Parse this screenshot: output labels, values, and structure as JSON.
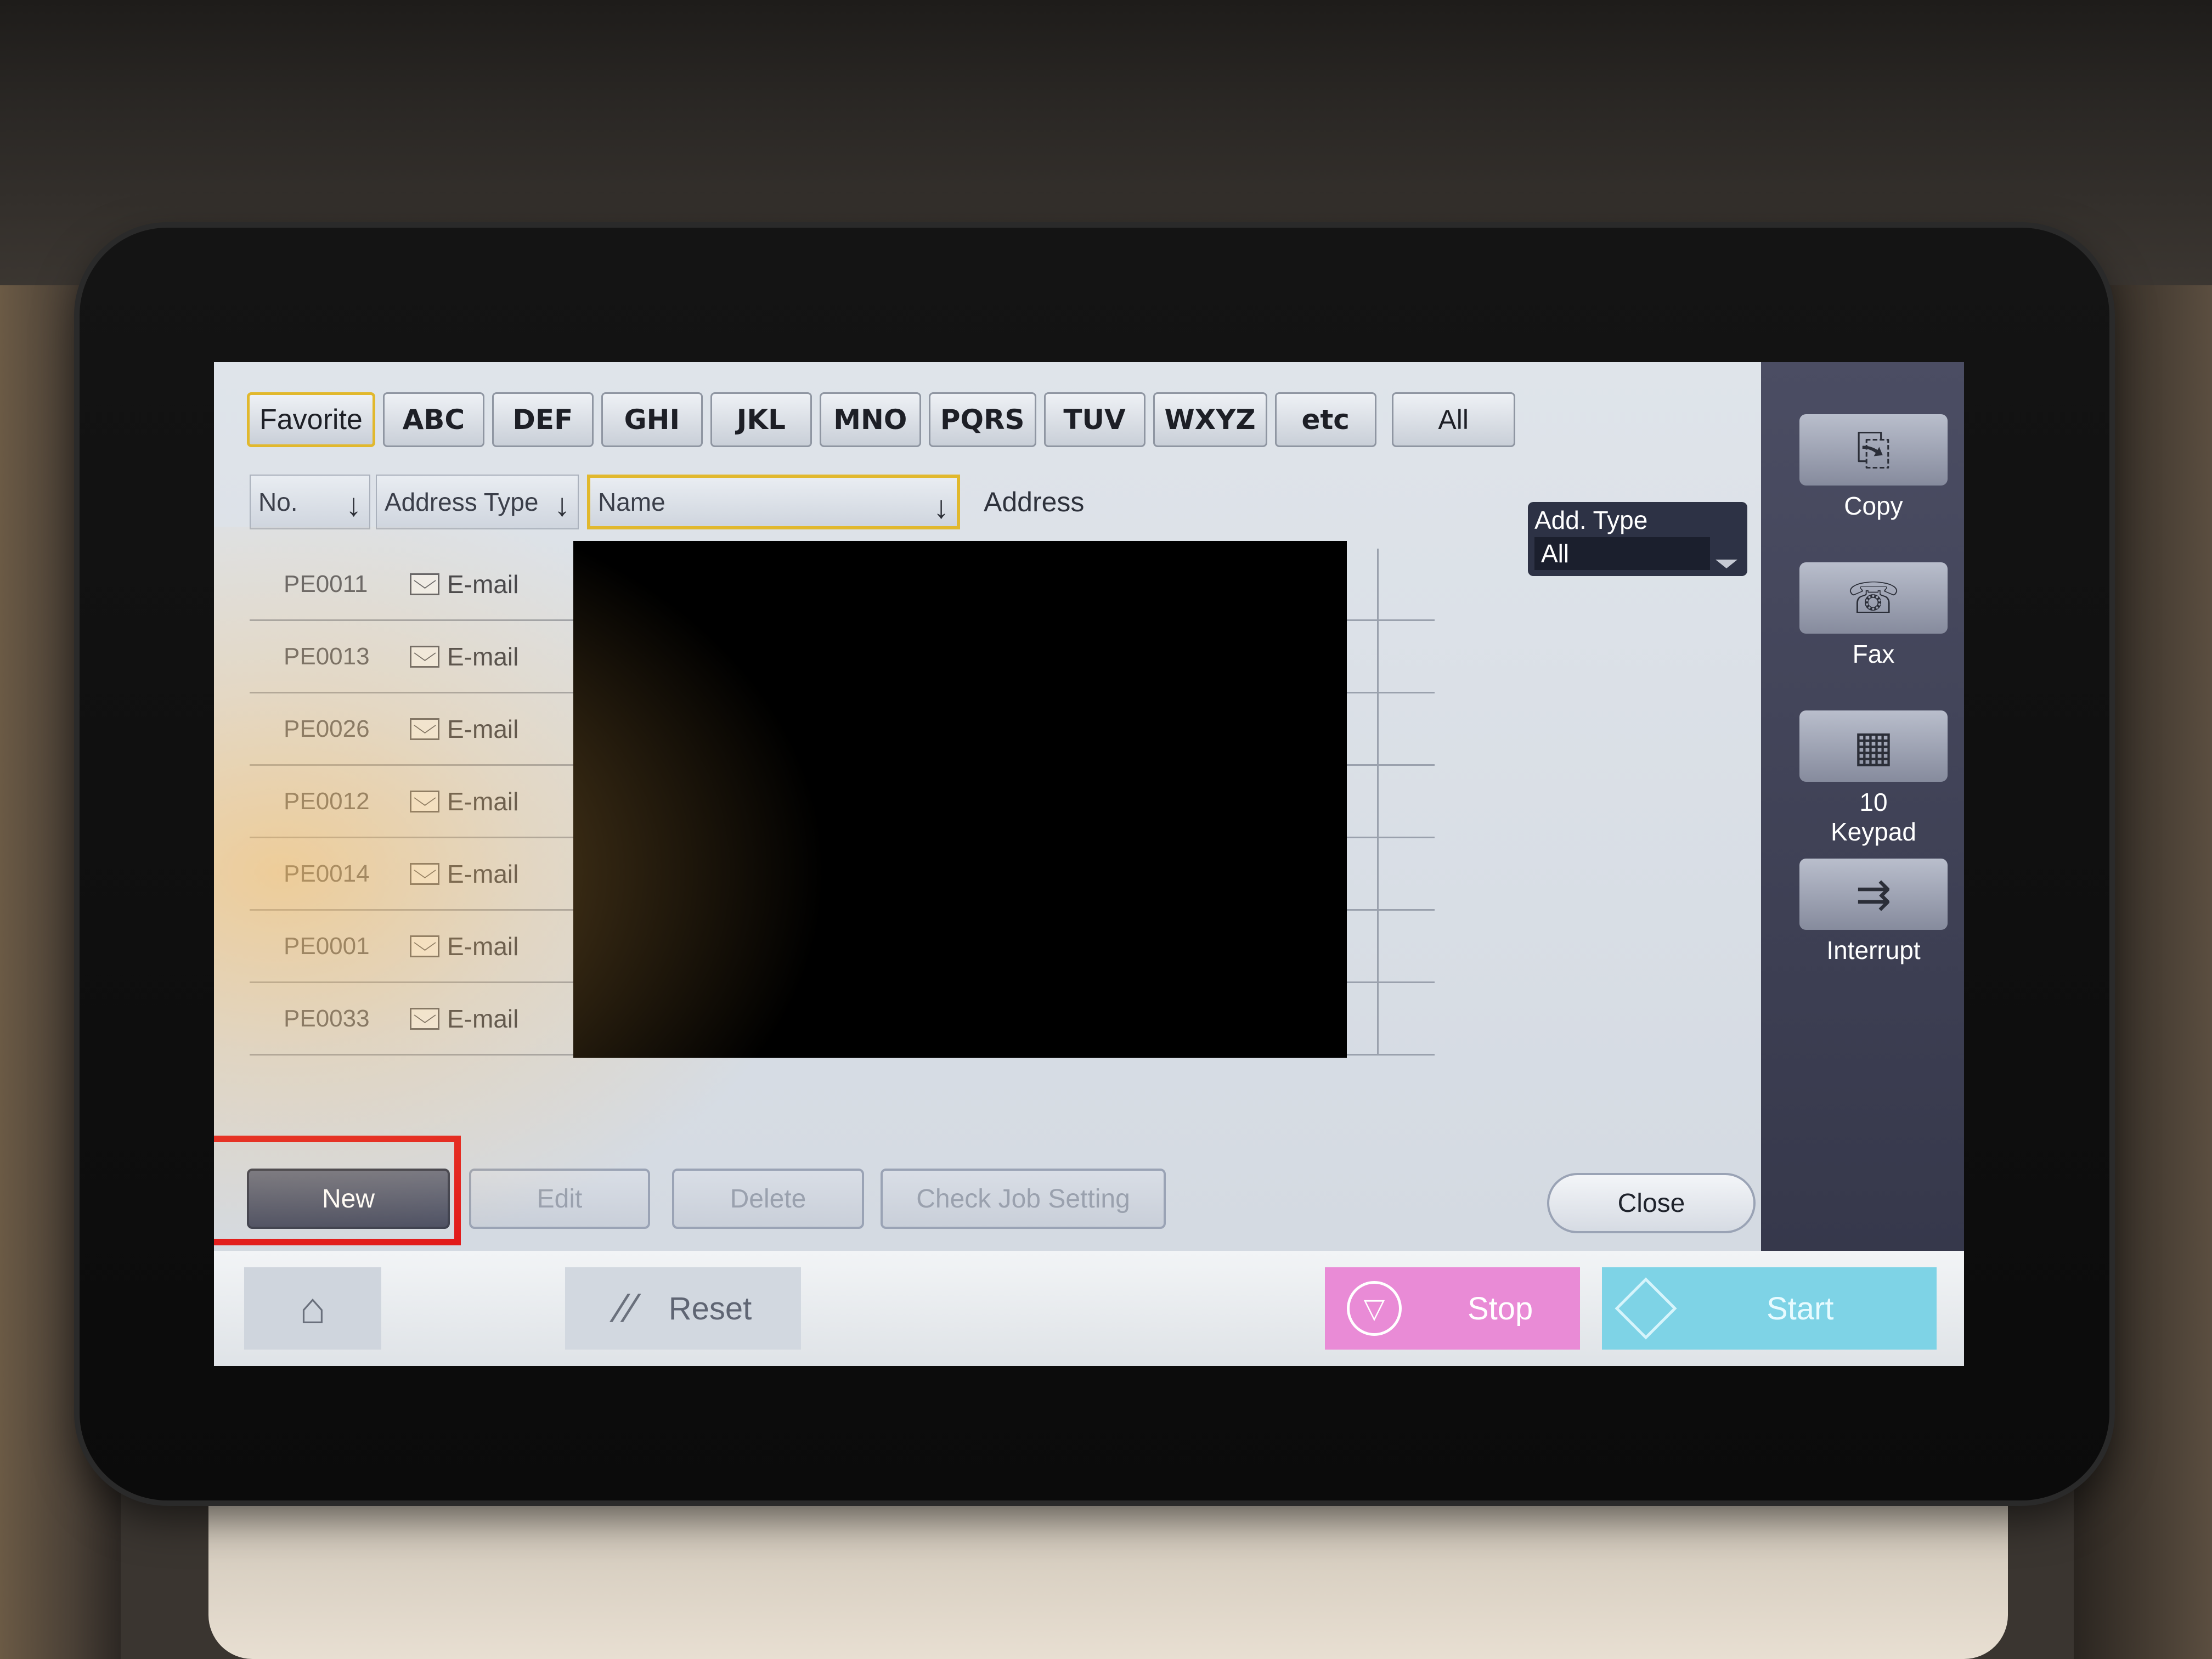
{
  "tabs": {
    "favorite": "Favorite",
    "abc": "ABC",
    "def": "DEF",
    "ghi": "GHI",
    "jkl": "JKL",
    "mno": "MNO",
    "pqrs": "PQRS",
    "tuv": "TUV",
    "wxyz": "WXYZ",
    "etc": "etc",
    "all": "All"
  },
  "columns": {
    "no": "No.",
    "address_type": "Address Type",
    "name": "Name",
    "address": "Address"
  },
  "rows": [
    {
      "no": "PE0011",
      "type": "E-mail"
    },
    {
      "no": "PE0013",
      "type": "E-mail"
    },
    {
      "no": "PE0026",
      "type": "E-mail"
    },
    {
      "no": "PE0012",
      "type": "E-mail"
    },
    {
      "no": "PE0014",
      "type": "E-mail"
    },
    {
      "no": "PE0001",
      "type": "E-mail"
    },
    {
      "no": "PE0033",
      "type": "E-mail"
    }
  ],
  "add_type": {
    "label": "Add. Type",
    "value": "All"
  },
  "actions": {
    "new": "New",
    "edit": "Edit",
    "delete": "Delete",
    "check_job": "Check Job Setting",
    "close": "Close"
  },
  "side": {
    "copy": "Copy",
    "fax": "Fax",
    "keypad_line1": "10",
    "keypad_line2": "Keypad",
    "interrupt": "Interrupt"
  },
  "bottom": {
    "reset": "Reset",
    "stop": "Stop",
    "start": "Start"
  },
  "colors": {
    "highlight": "#e21b1b",
    "selected_border": "#e1b82d",
    "stop": "#e98bd6",
    "start": "#7ed3e6"
  }
}
